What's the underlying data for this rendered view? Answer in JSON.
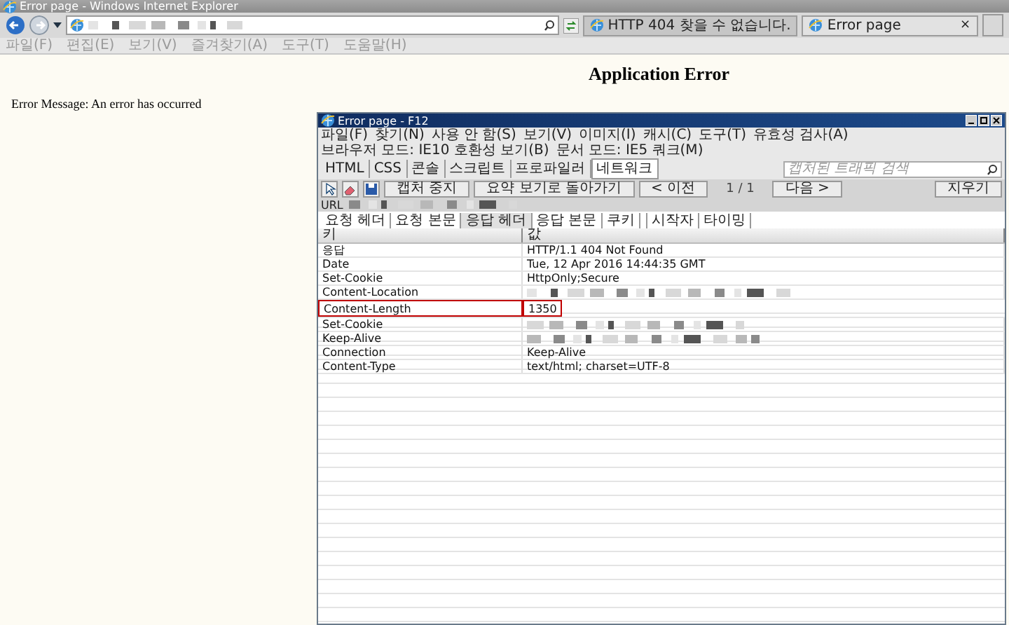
{
  "window": {
    "title": "Error page - Windows Internet Explorer"
  },
  "tabs": [
    {
      "label": "HTTP 404 찾을 수 없습니다.",
      "selected": false
    },
    {
      "label": "Error page",
      "selected": true,
      "close": "×"
    }
  ],
  "menu": [
    "파일(F)",
    "편집(E)",
    "보기(V)",
    "즐겨찾기(A)",
    "도구(T)",
    "도움말(H)"
  ],
  "page": {
    "heading": "Application Error",
    "message": "Error Message: An error has occurred"
  },
  "devtools": {
    "title": "Error page - F12",
    "menu": [
      "파일(F)",
      "찾기(N)",
      "사용 안 함(S)",
      "보기(V)",
      "이미지(I)",
      "캐시(C)",
      "도구(T)",
      "유효성 검사(A)",
      "브라우저 모드: IE10 호환성 보기(B)",
      "문서 모드: IE5 쿼크(M)"
    ],
    "tabs": [
      {
        "label": "HTML",
        "selected": false
      },
      {
        "label": "CSS",
        "selected": false
      },
      {
        "label": "콘솔",
        "selected": false
      },
      {
        "label": "스크립트",
        "selected": false
      },
      {
        "label": "프로파일러",
        "selected": false
      },
      {
        "label": "네트워크",
        "selected": true
      }
    ],
    "search": {
      "placeholder": "캡처된 트래픽 검색"
    },
    "controls": [
      {
        "kind": "button",
        "label": "캡처 중지"
      },
      {
        "kind": "button",
        "label": "요약 보기로 돌아가기"
      },
      {
        "kind": "button",
        "label": "< 이전"
      },
      {
        "kind": "counter",
        "label": "1 / 1"
      },
      {
        "kind": "button",
        "label": "다음 >"
      }
    ],
    "clear_button": "지우기",
    "url_label": "URL",
    "subtabs": [
      {
        "label": "요청 헤더",
        "selected": false
      },
      {
        "label": "요청 본문",
        "selected": false
      },
      {
        "label": "응답 헤더",
        "selected": true
      },
      {
        "label": "응답 본문",
        "selected": false
      },
      {
        "label": "쿠키",
        "selected": false
      },
      {
        "label": "시작자",
        "selected": false
      },
      {
        "label": "타이밍",
        "selected": false
      }
    ],
    "columns": [
      "키",
      "값"
    ],
    "rows": [
      {
        "key": "응답",
        "kind": "text",
        "value": "HTTP/1.1 404 Not Found",
        "highlighted": false
      },
      {
        "key": "Date",
        "kind": "text",
        "value": "Tue, 12 Apr 2016 14:44:35 GMT",
        "highlighted": false
      },
      {
        "key": "Set-Cookie",
        "kind": "text",
        "value": "HttpOnly;Secure",
        "highlighted": false
      },
      {
        "key": "Content-Location",
        "kind": "redacted",
        "highlighted": false
      },
      {
        "key": "Content-Length",
        "kind": "text",
        "value": "1350",
        "highlighted": true
      },
      {
        "key": "Set-Cookie",
        "kind": "redacted",
        "highlighted": false
      },
      {
        "key": "Keep-Alive",
        "kind": "redacted",
        "highlighted": false
      },
      {
        "key": "Connection",
        "kind": "text",
        "value": "Keep-Alive",
        "highlighted": false
      },
      {
        "key": "Content-Type",
        "kind": "text",
        "value": "text/html; charset=UTF-8",
        "highlighted": false
      }
    ]
  }
}
